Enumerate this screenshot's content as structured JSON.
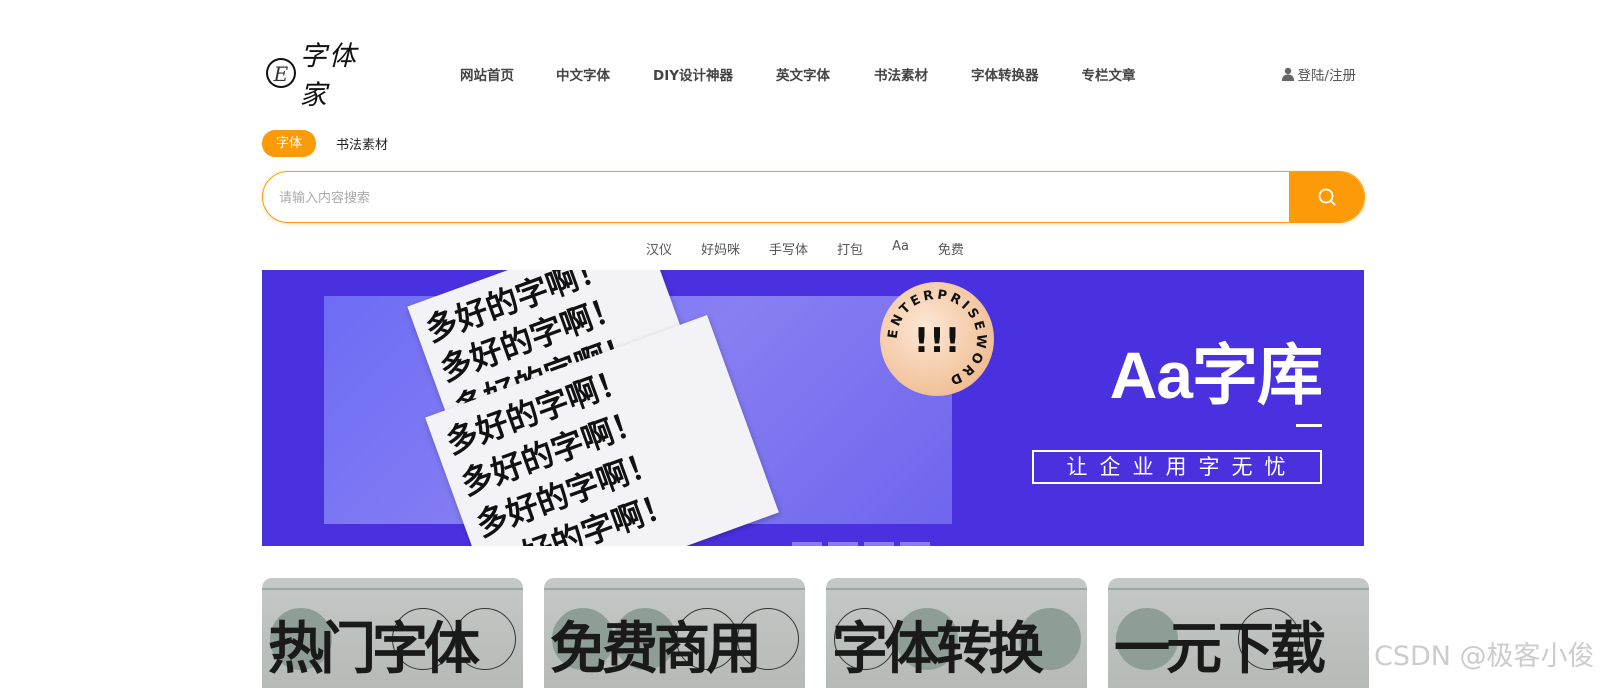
{
  "header": {
    "logo_mark": "E",
    "logo_text": "字体家",
    "nav": [
      "网站首页",
      "中文字体",
      "DIY设计神器",
      "英文字体",
      "书法素材",
      "字体转换器",
      "专栏文章"
    ],
    "login_label": "登陆/注册"
  },
  "tabs": {
    "active": "字体",
    "other": "书法素材"
  },
  "search": {
    "placeholder": "请输入内容搜索",
    "value": "",
    "button_icon": "search-icon"
  },
  "hot_words": [
    "汉仪",
    "好妈咪",
    "手写体",
    "打包",
    "Aa",
    "免费"
  ],
  "banner": {
    "paper_line": "多好的字啊！",
    "badge_text": "ENTERPRISEWORD",
    "badge_mark": "!!!",
    "title": "Aa字库",
    "dash": "—",
    "slogan": "让企业用字无忧"
  },
  "cards": [
    {
      "label": "热门字体"
    },
    {
      "label": "免费商用"
    },
    {
      "label": "字体转换"
    },
    {
      "label": "一元下载"
    }
  ],
  "watermark": "CSDN @极客小俊",
  "colors": {
    "accent": "#fb9b0a",
    "banner_bg": "#4a31e0"
  }
}
